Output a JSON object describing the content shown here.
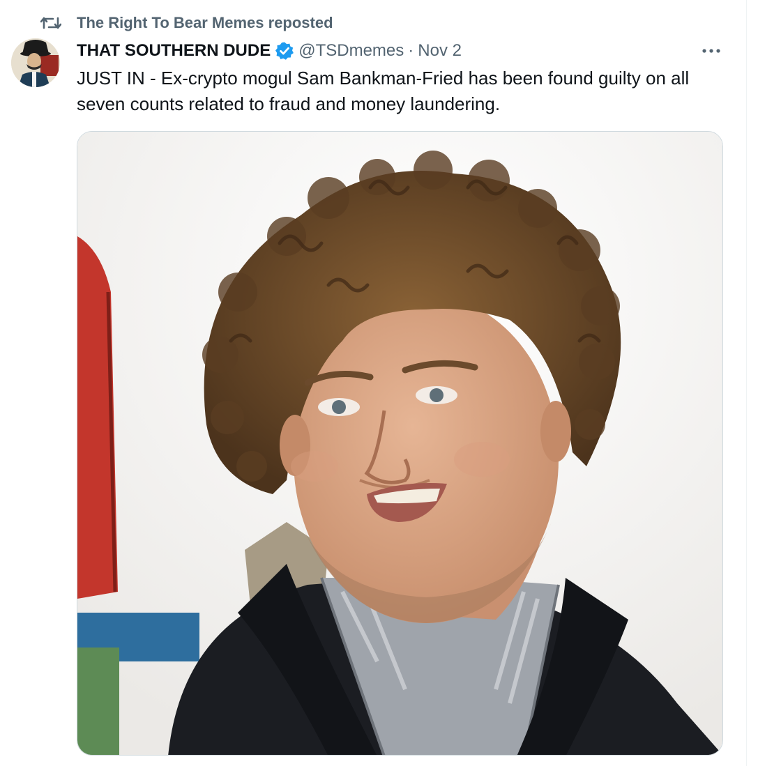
{
  "repost": {
    "icon": "repost-icon",
    "text": "The Right To Bear Memes reposted"
  },
  "author": {
    "display_name": "THAT SOUTHERN DUDE",
    "verified_icon": "verified-badge-icon",
    "handle": "@TSDmemes",
    "separator": "·",
    "date": "Nov 2"
  },
  "tweet": {
    "text": "JUST IN - Ex-crypto mogul Sam Bankman-Fried has been found guilty on all seven counts related to fraud and money laundering."
  },
  "media": {
    "kind": "photo"
  },
  "more_icon": "more-horizontal-icon",
  "colors": {
    "text_primary": "#0f1419",
    "text_secondary": "#536471",
    "verified_blue": "#1d9bf0",
    "border": "#cfd9de"
  }
}
